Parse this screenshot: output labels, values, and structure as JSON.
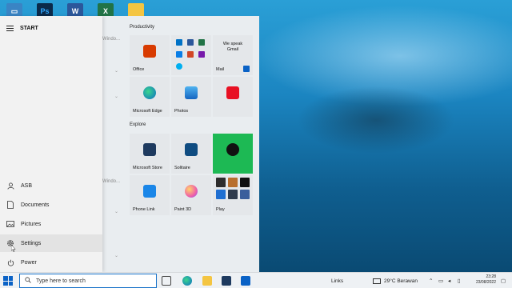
{
  "desktop": {
    "icons": [
      "Ps",
      "W",
      "X"
    ]
  },
  "start_menu": {
    "title": "START",
    "rail": [
      {
        "label": "ASB",
        "icon": "user-icon"
      },
      {
        "label": "Documents",
        "icon": "document-icon"
      },
      {
        "label": "Pictures",
        "icon": "pictures-icon"
      },
      {
        "label": "Settings",
        "icon": "gear-icon"
      },
      {
        "label": "Power",
        "icon": "power-icon"
      }
    ],
    "behind_text": [
      "Windo...",
      "Windo..."
    ],
    "sections": [
      "Productivity",
      "Explore"
    ],
    "tiles": {
      "office": "Office",
      "gmail": "We speak Gmail",
      "mail": "Mail",
      "edge": "Microsoft Edge",
      "photos": "Photos",
      "store": "Microsoft Store",
      "solitaire": "Solitaire",
      "phone_link": "Phone Link",
      "paint3d": "Paint 3D",
      "play": "Play"
    }
  },
  "taskbar": {
    "search_placeholder": "Type here to search",
    "links": "Links",
    "weather": "29°C  Berawan",
    "time": "23:28",
    "date": "23/08/2022"
  },
  "colors": {
    "accent": "#0a62c6",
    "spotify": "#1db954"
  }
}
